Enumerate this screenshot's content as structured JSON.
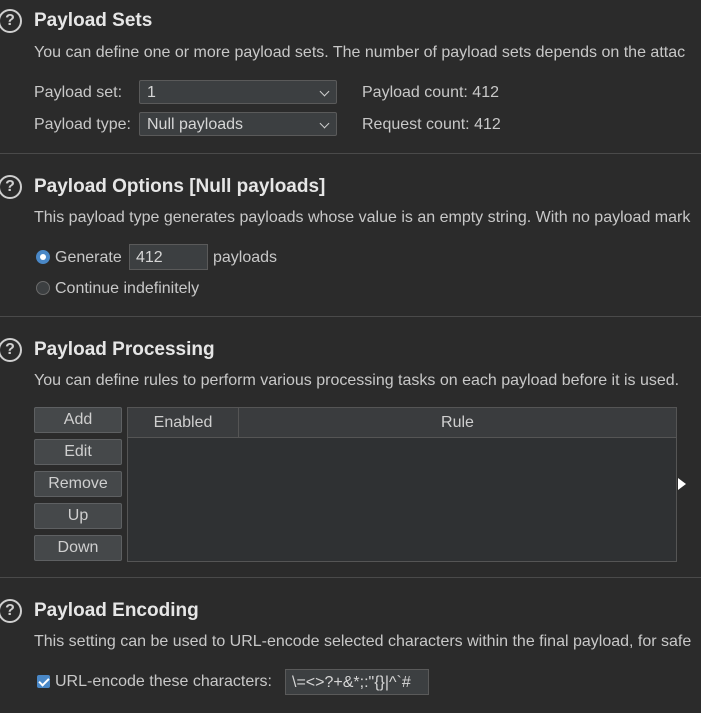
{
  "payload_sets": {
    "help_icon": "?",
    "title": "Payload Sets",
    "description": "You can define one or more payload sets. The number of payload sets depends on the attac",
    "payload_set_label": "Payload set:",
    "payload_set_value": "1",
    "payload_type_label": "Payload type:",
    "payload_type_value": "Null payloads",
    "payload_count": "Payload count: 412",
    "request_count": "Request count: 412"
  },
  "payload_options": {
    "help_icon": "?",
    "title": "Payload Options [Null payloads]",
    "description": "This payload type generates payloads whose value is an empty string. With no payload mark",
    "generate_label": "Generate",
    "generate_value": "412",
    "payloads_label": "payloads",
    "continue_label": "Continue indefinitely",
    "selected": "generate"
  },
  "payload_processing": {
    "help_icon": "?",
    "title": "Payload Processing",
    "description": "You can define rules to perform various processing tasks on each payload before it is used.",
    "buttons": [
      "Add",
      "Edit",
      "Remove",
      "Up",
      "Down"
    ],
    "columns": [
      "Enabled",
      "Rule"
    ]
  },
  "payload_encoding": {
    "help_icon": "?",
    "title": "Payload Encoding",
    "description": "This setting can be used to URL-encode selected characters within the final payload, for safe",
    "urlencode_label": "URL-encode these characters:",
    "urlencode_checked": true,
    "characters": "\\=<>?+&*;:\"{}|^`#"
  },
  "colors": {
    "background": "#2b2b2b",
    "accent": "#4a88c7"
  }
}
